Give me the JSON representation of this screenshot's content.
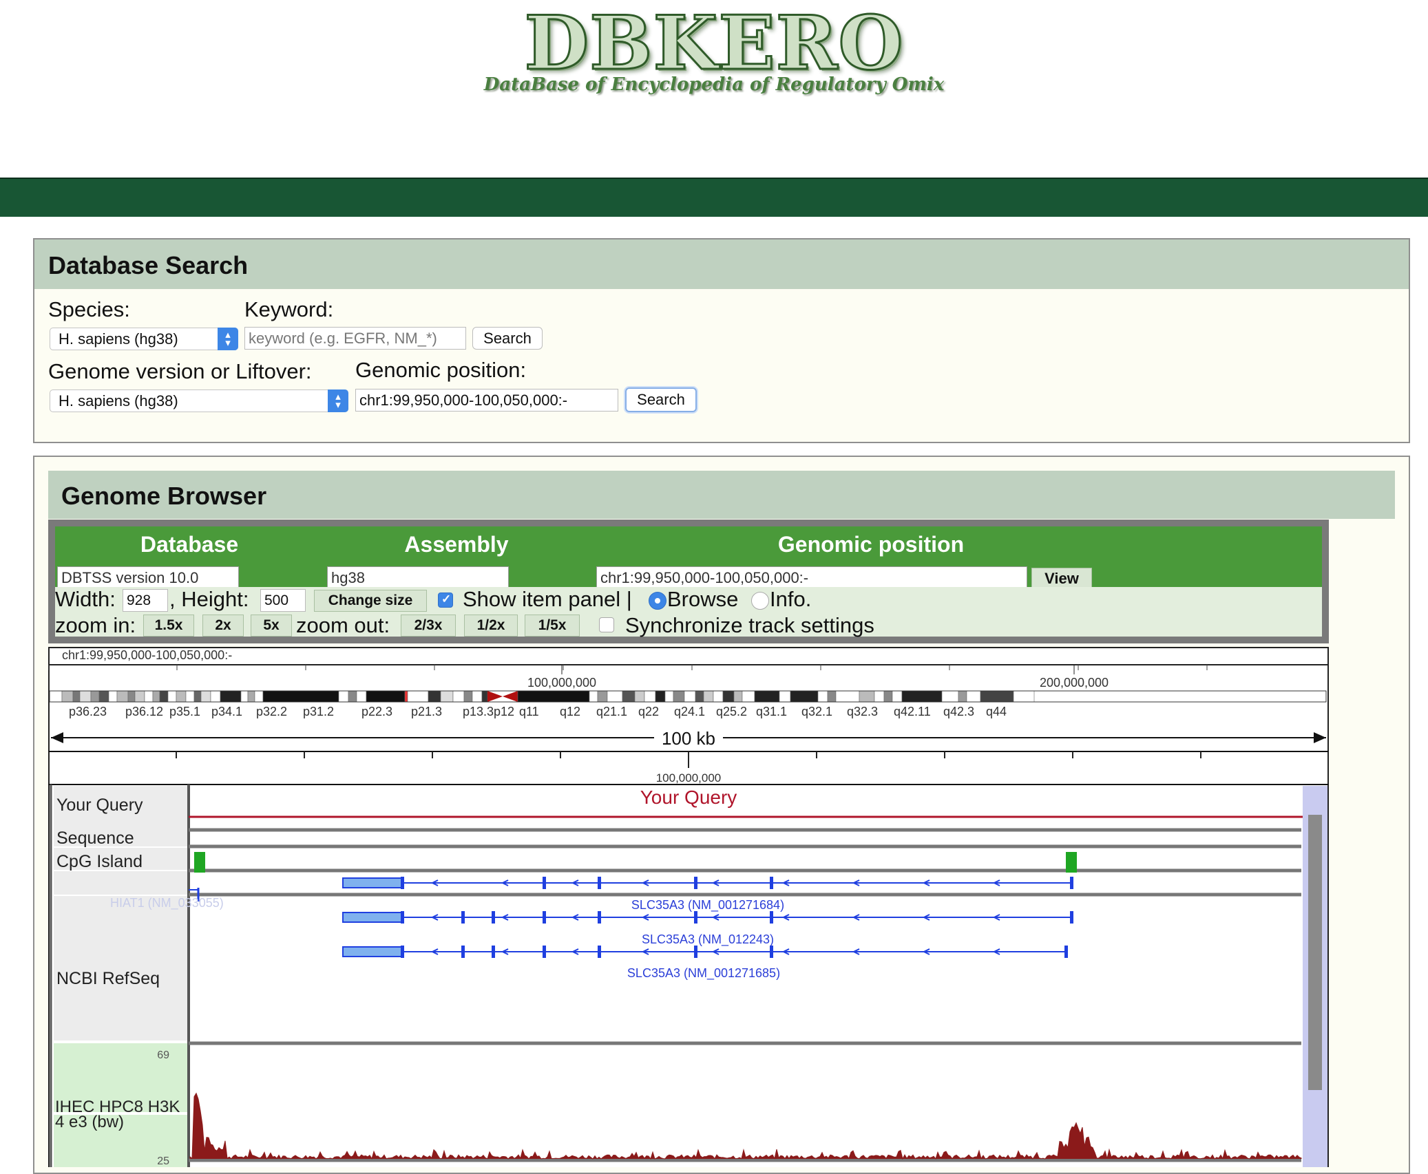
{
  "logo": {
    "title": "DBKERO",
    "subtitle": "DataBase of Encyclopedia of Regulatory Omix"
  },
  "search": {
    "heading": "Database Search",
    "species_label": "Species:",
    "species_value": "H. sapiens (hg38)",
    "keyword_label": "Keyword:",
    "keyword_placeholder": "keyword (e.g. EGFR, NM_*)",
    "keyword_button": "Search",
    "genome_label": "Genome version or Liftover:",
    "genome_value": "H. sapiens (hg38)",
    "position_label": "Genomic position:",
    "position_value": "chr1:99,950,000-100,050,000:-",
    "position_button": "Search"
  },
  "browser": {
    "heading": "Genome Browser",
    "col_database": "Database",
    "col_assembly": "Assembly",
    "col_position": "Genomic position",
    "database_value": "DBTSS version 10.0",
    "assembly_value": "hg38",
    "position_value": "chr1:99,950,000-100,050,000:-",
    "view_button": "View",
    "width_label": "Width:",
    "width_value": "928",
    "height_label": ", Height:",
    "height_value": "500",
    "change_size_button": "Change size",
    "show_panel_label": "Show item panel |",
    "browse_label": "Browse",
    "info_label": "Info.",
    "zoom_in_label": "zoom in:",
    "zoom_in": [
      "1.5x",
      "2x",
      "5x"
    ],
    "zoom_out_label": "zoom out:",
    "zoom_out": [
      "2/3x",
      "1/2x",
      "1/5x"
    ],
    "sync_label": "Synchronize track settings",
    "show_panel_checked": true,
    "sync_checked": false,
    "mode": "Browse"
  },
  "view": {
    "region_text": "chr1:99,950,000-100,050,000:-",
    "chrom_tick_100m": "100,000,000",
    "chrom_tick_200m": "200,000,000",
    "bands": [
      "p36.23",
      "p36.12",
      "p35.1",
      "p34.1",
      "p32.2",
      "p31.2",
      "p22.3",
      "p21.3",
      "p13.3",
      "p12",
      "q11",
      "q12",
      "q21.1",
      "q22",
      "q24.1",
      "q25.2",
      "q31.1",
      "q32.1",
      "q32.3",
      "q42.11",
      "q42.3",
      "q44"
    ],
    "scale_text": "100 kb",
    "coord_tick": "100,000,000",
    "query_label": "Your Query",
    "tracks": [
      "Your Query",
      "Sequence",
      "CpG Island",
      "NCBI RefSeq",
      "IHEC HPC8 H3K4 e3 (bw)"
    ],
    "hidden_gene": "HIAT1 (NM_033055)",
    "transcripts": [
      "SLC35A3 (NM_001271684)",
      "SLC35A3 (NM_012243)",
      "SLC35A3 (NM_001271685)"
    ],
    "signal_max": "69",
    "next_track_max": "25"
  },
  "colors": {
    "header_green": "#185634",
    "panel_head": "#bfd1c0",
    "control_green": "#4a9a3a",
    "gene_blue": "#1f3fe0",
    "query_red": "#b0152b",
    "signal_red": "#8b1a1a",
    "cpg_green": "#1fa623"
  }
}
